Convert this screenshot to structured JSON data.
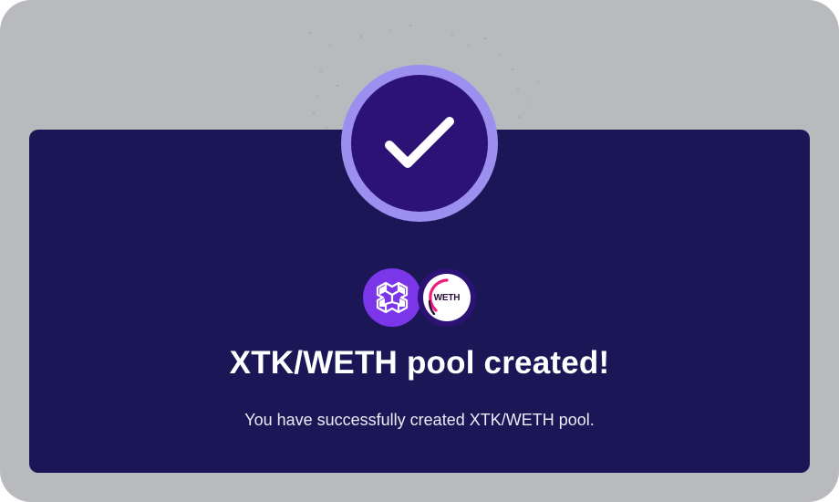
{
  "dialog": {
    "title": "XTK/WETH pool created!",
    "message": "You have successfully created XTK/WETH pool.",
    "status_icon": "checkmark-icon"
  },
  "tokens": [
    {
      "symbol": "XTK",
      "icon": "xtk-token-icon",
      "color": "#7a36e8"
    },
    {
      "symbol": "WETH",
      "icon": "weth-token-icon",
      "label": "WETH",
      "color": "#2d1275"
    }
  ],
  "colors": {
    "backdrop": "#b9babd",
    "panel": "#1b1756",
    "badge": "#2d1275",
    "badge_ring": "#9d8ff0",
    "text": "#ffffff"
  }
}
